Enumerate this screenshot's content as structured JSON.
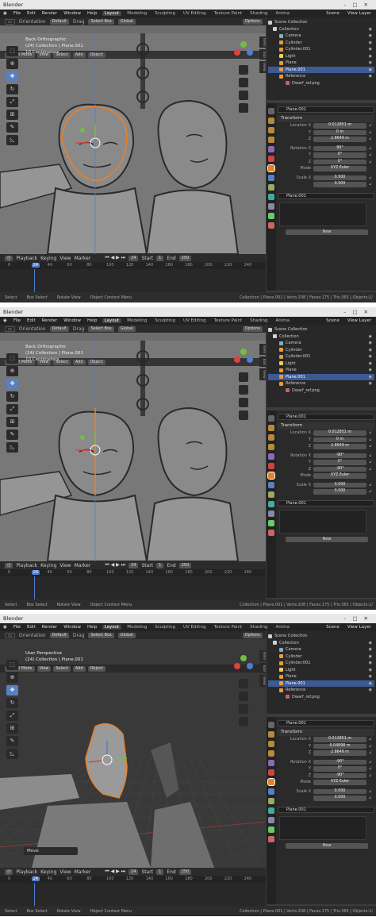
{
  "app_title": "Blender",
  "menu": [
    "File",
    "Edit",
    "Render",
    "Window",
    "Help"
  ],
  "workspaces": [
    "Layout",
    "Modeling",
    "Sculpting",
    "UV Editing",
    "Texture Paint",
    "Shading",
    "Anima"
  ],
  "scene_label": "Scene",
  "view_layer_label": "View Layer",
  "tool_header": {
    "orientation_label": "Orientation",
    "orientation_value": "Default",
    "drag_label": "Drag",
    "select_box": "Select Box",
    "global": "Global",
    "options": "Options"
  },
  "view_header": {
    "mode": "Object Mode",
    "items": [
      "View",
      "Select",
      "Add",
      "Object"
    ]
  },
  "toolbar_icons": [
    "cursor-select-icon",
    "cursor-icon",
    "move-icon",
    "rotate-icon",
    "scale-icon",
    "transform-icon",
    "annotate-icon",
    "measure-icon"
  ],
  "side_tabs": [
    "Item",
    "Tool",
    "View"
  ],
  "timeline": {
    "menus": [
      "Playback",
      "Keying",
      "View",
      "Marker"
    ],
    "current_frame": "24",
    "start_label": "Start",
    "start": "1",
    "end_label": "End",
    "end": "250",
    "ticks": [
      "0",
      "24",
      "40",
      "60",
      "80",
      "100",
      "120",
      "140",
      "160",
      "180",
      "200",
      "220",
      "240"
    ]
  },
  "statusbar": {
    "items": [
      "Select",
      "Box Select",
      "Rotate View",
      "Object Context Menu"
    ],
    "stats": "Collection | Plane.001 | Verts:208 | Faces:175 | Tris:365 | Objects:1/"
  },
  "outliner": {
    "root": "Scene Collection",
    "rows": [
      {
        "label": "Collection",
        "color": "#d0d0d0"
      },
      {
        "label": "Camera",
        "color": "#7fb0c0"
      },
      {
        "label": "Cylinder",
        "color": "#e89a3c"
      },
      {
        "label": "Cylinder.001",
        "color": "#e89a3c"
      },
      {
        "label": "Light",
        "color": "#e8d060"
      },
      {
        "label": "Plane",
        "color": "#e89a3c"
      },
      {
        "label": "Plane.001",
        "color": "#e89a3c",
        "selected": true
      },
      {
        "label": "Reference",
        "color": "#e89a3c"
      },
      {
        "label": "Dwarf_ref.png",
        "color": "#bb6666"
      }
    ]
  },
  "properties": {
    "object_name": "Plane.001",
    "transform_title": "Transform",
    "mode_label": "Mode",
    "mode_value": "XYZ Euler",
    "scale_label": "Scale X",
    "scale_value": "0.500",
    "scale_y": "0.500",
    "data_name": "Plane.001",
    "new_button": "New"
  },
  "screens": [
    {
      "vp_line1": "Back Orthographic",
      "vp_line2": "(24) Collection | Plane.001",
      "vp_line3": "10 Centimeters",
      "location": [
        {
          "lbl": "Location X",
          "val": "0.012851 m"
        },
        {
          "lbl": "Y",
          "val": "0 m"
        },
        {
          "lbl": "Z",
          "val": "2.8649 m"
        }
      ],
      "rotation": [
        {
          "lbl": "Rotation X",
          "val": "90°"
        },
        {
          "lbl": "Y",
          "val": "0°"
        },
        {
          "lbl": "Z",
          "val": "0°"
        }
      ],
      "show_move": false
    },
    {
      "vp_line1": "Back Orthographic",
      "vp_line2": "(24) Collection | Plane.001",
      "vp_line3": "10 Centimeters",
      "location": [
        {
          "lbl": "Location X",
          "val": "0.012851 m"
        },
        {
          "lbl": "Y",
          "val": "0 m"
        },
        {
          "lbl": "Z",
          "val": "2.8649 m"
        }
      ],
      "rotation": [
        {
          "lbl": "Rotation X",
          "val": "-90°"
        },
        {
          "lbl": "Y",
          "val": "0°"
        },
        {
          "lbl": "Z",
          "val": "-90°"
        }
      ],
      "show_move": false
    },
    {
      "vp_line1": "User Perspective",
      "vp_line2": "(24) Collection | Plane.001",
      "vp_line3": "",
      "location": [
        {
          "lbl": "Location X",
          "val": "0.012851 m"
        },
        {
          "lbl": "Y",
          "val": "0.04898 m"
        },
        {
          "lbl": "Z",
          "val": "2.8649 m"
        }
      ],
      "rotation": [
        {
          "lbl": "Rotation X",
          "val": "-90°"
        },
        {
          "lbl": "Y",
          "val": "0°"
        },
        {
          "lbl": "Z",
          "val": "-90°"
        }
      ],
      "show_move": true,
      "move_label": "Move"
    }
  ]
}
